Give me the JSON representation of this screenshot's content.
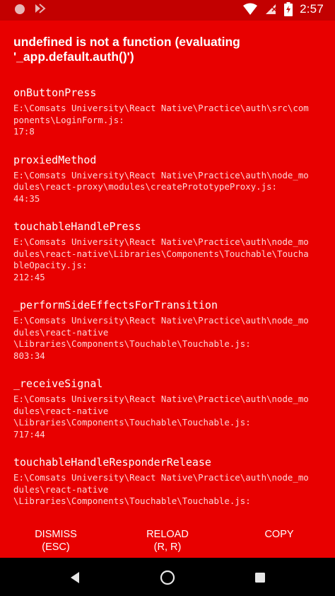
{
  "status_bar": {
    "time": "2:57",
    "icons": [
      "circle-icon",
      "notification-icon",
      "wifi-icon",
      "no-sim-icon",
      "battery-charging-icon"
    ]
  },
  "error": {
    "title": "undefined is not a function (evaluating '_app.default.auth()')"
  },
  "stack": [
    {
      "method": "onButtonPress",
      "path": "E:\\Comsats University\\React Native\\Practice\\auth\\src\\components\\LoginForm.js:\n17:8"
    },
    {
      "method": "proxiedMethod",
      "path": "E:\\Comsats University\\React Native\\Practice\\auth\\node_modules\\react-proxy\\modules\\createPrototypeProxy.js:\n44:35"
    },
    {
      "method": "touchableHandlePress",
      "path": "E:\\Comsats University\\React Native\\Practice\\auth\\node_modules\\react-native\\Libraries\\Components\\Touchable\\TouchableOpacity.js:\n212:45"
    },
    {
      "method": "_performSideEffectsForTransition",
      "path": "E:\\Comsats University\\React Native\\Practice\\auth\\node_modules\\react-native\n\\Libraries\\Components\\Touchable\\Touchable.js:\n803:34"
    },
    {
      "method": "_receiveSignal",
      "path": "E:\\Comsats University\\React Native\\Practice\\auth\\node_modules\\react-native\n\\Libraries\\Components\\Touchable\\Touchable.js:\n717:44"
    },
    {
      "method": "touchableHandleResponderRelease",
      "path": "E:\\Comsats University\\React Native\\Practice\\auth\\node_modules\\react-native\n\\Libraries\\Components\\Touchable\\Touchable.js:"
    }
  ],
  "buttons": {
    "dismiss": {
      "label": "DISMISS",
      "shortcut": "(ESC)"
    },
    "reload": {
      "label": "RELOAD",
      "shortcut": "(R, R)"
    },
    "copy": {
      "label": "COPY"
    }
  },
  "nav": {
    "icons": [
      "back-icon",
      "home-icon",
      "recents-icon"
    ]
  },
  "colors": {
    "background": "#e80000",
    "status_bar": "#c20000",
    "nav_bar": "#000000",
    "text": "#ffffff"
  }
}
